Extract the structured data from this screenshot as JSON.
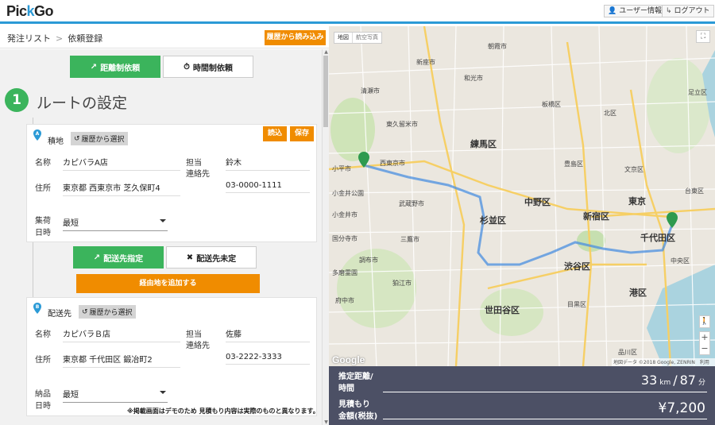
{
  "header": {
    "logo_a": "Pic",
    "logo_k": "k",
    "logo_b": "Go",
    "user_info": "ユーザー情報",
    "logout": "ログアウト"
  },
  "breadcrumb": {
    "parent": "発注リスト",
    "separator": ">",
    "current": "依頼登録",
    "history_load": "履歴から読み込み"
  },
  "modes": {
    "distance": "距離制依頼",
    "time": "時間制依頼"
  },
  "step": {
    "number": "1",
    "title": "ルートの設定"
  },
  "pickup": {
    "pin_letter": "A",
    "label": "積地",
    "history_select": "履歴から選択",
    "load_button": "読込",
    "save_button": "保存",
    "name_label": "名称",
    "name_value": "カピバラA店",
    "address_label": "住所",
    "address_value": "東京都 西東京市 芝久保町4",
    "contact_label_1": "担当",
    "contact_label_2": "連絡先",
    "contact_name": "鈴木",
    "contact_phone": "03-0000-1111",
    "time_label_1": "集荷",
    "time_label_2": "日時",
    "time_value": "最短"
  },
  "delivery_mode": {
    "specified": "配送先指定",
    "unspecified": "配送先未定"
  },
  "waypoint_button": "経由地を追加する",
  "delivery": {
    "pin_letter": "B",
    "label": "配送先",
    "history_select": "履歴から選択",
    "name_label": "名称",
    "name_value": "カピバラＢ店",
    "address_label": "住所",
    "address_value": "東京都 千代田区 鍛冶町2",
    "contact_label_1": "担当",
    "contact_label_2": "連絡先",
    "contact_name": "佐藤",
    "contact_phone": "03-2222-3333",
    "time_label_1": "納品",
    "time_label_2": "日時",
    "time_value": "最短"
  },
  "disclaimer": "※掲載画面はデモのため 見積もり内容は実際のものと異なります。",
  "map": {
    "toggle_map": "地図",
    "toggle_satellite": "航空写真",
    "google": "Google",
    "attribution": "地図データ ©2018 Google, ZENRIN　利用規約",
    "labels": {
      "nerima": "練馬区",
      "nakano": "中野区",
      "suginami": "杉並区",
      "shinjuku": "新宿区",
      "tokyo": "東京",
      "chiyoda": "千代田区",
      "shibuya": "渋谷区",
      "setagaya": "世田谷区",
      "minato": "港区",
      "chuo": "中央区",
      "itabashi": "板橋区",
      "kita": "北区",
      "bunkyo": "文京区",
      "taito": "台東区",
      "adachi": "足立区",
      "musashino": "武蔵野市",
      "mitaka": "三鷹市",
      "chofu": "調布市",
      "komae": "狛江市",
      "shinagawa": "品川区",
      "nishitokyo": "西東京市",
      "koganei": "小金井市",
      "toshima": "豊島区",
      "meguro": "目黒区",
      "kodaira": "小平市",
      "niiza": "新座市",
      "wako": "和光市",
      "asaka": "朝霞市",
      "kiyose": "清瀬市",
      "higashikurume": "東久留米市",
      "fuchu": "府中市",
      "kokubunji": "国分寺市",
      "tama": "多磨霊園",
      "koganeipark": "小金井公園"
    }
  },
  "summary": {
    "distance_label_1": "推定距離/",
    "distance_label_2": "時間",
    "distance_value": "33",
    "distance_unit": "km",
    "slash": "/",
    "time_value": "87",
    "time_unit": "分",
    "price_label_1": "見積もり",
    "price_label_2": "金額(税抜)",
    "price_value": "¥7,200"
  }
}
